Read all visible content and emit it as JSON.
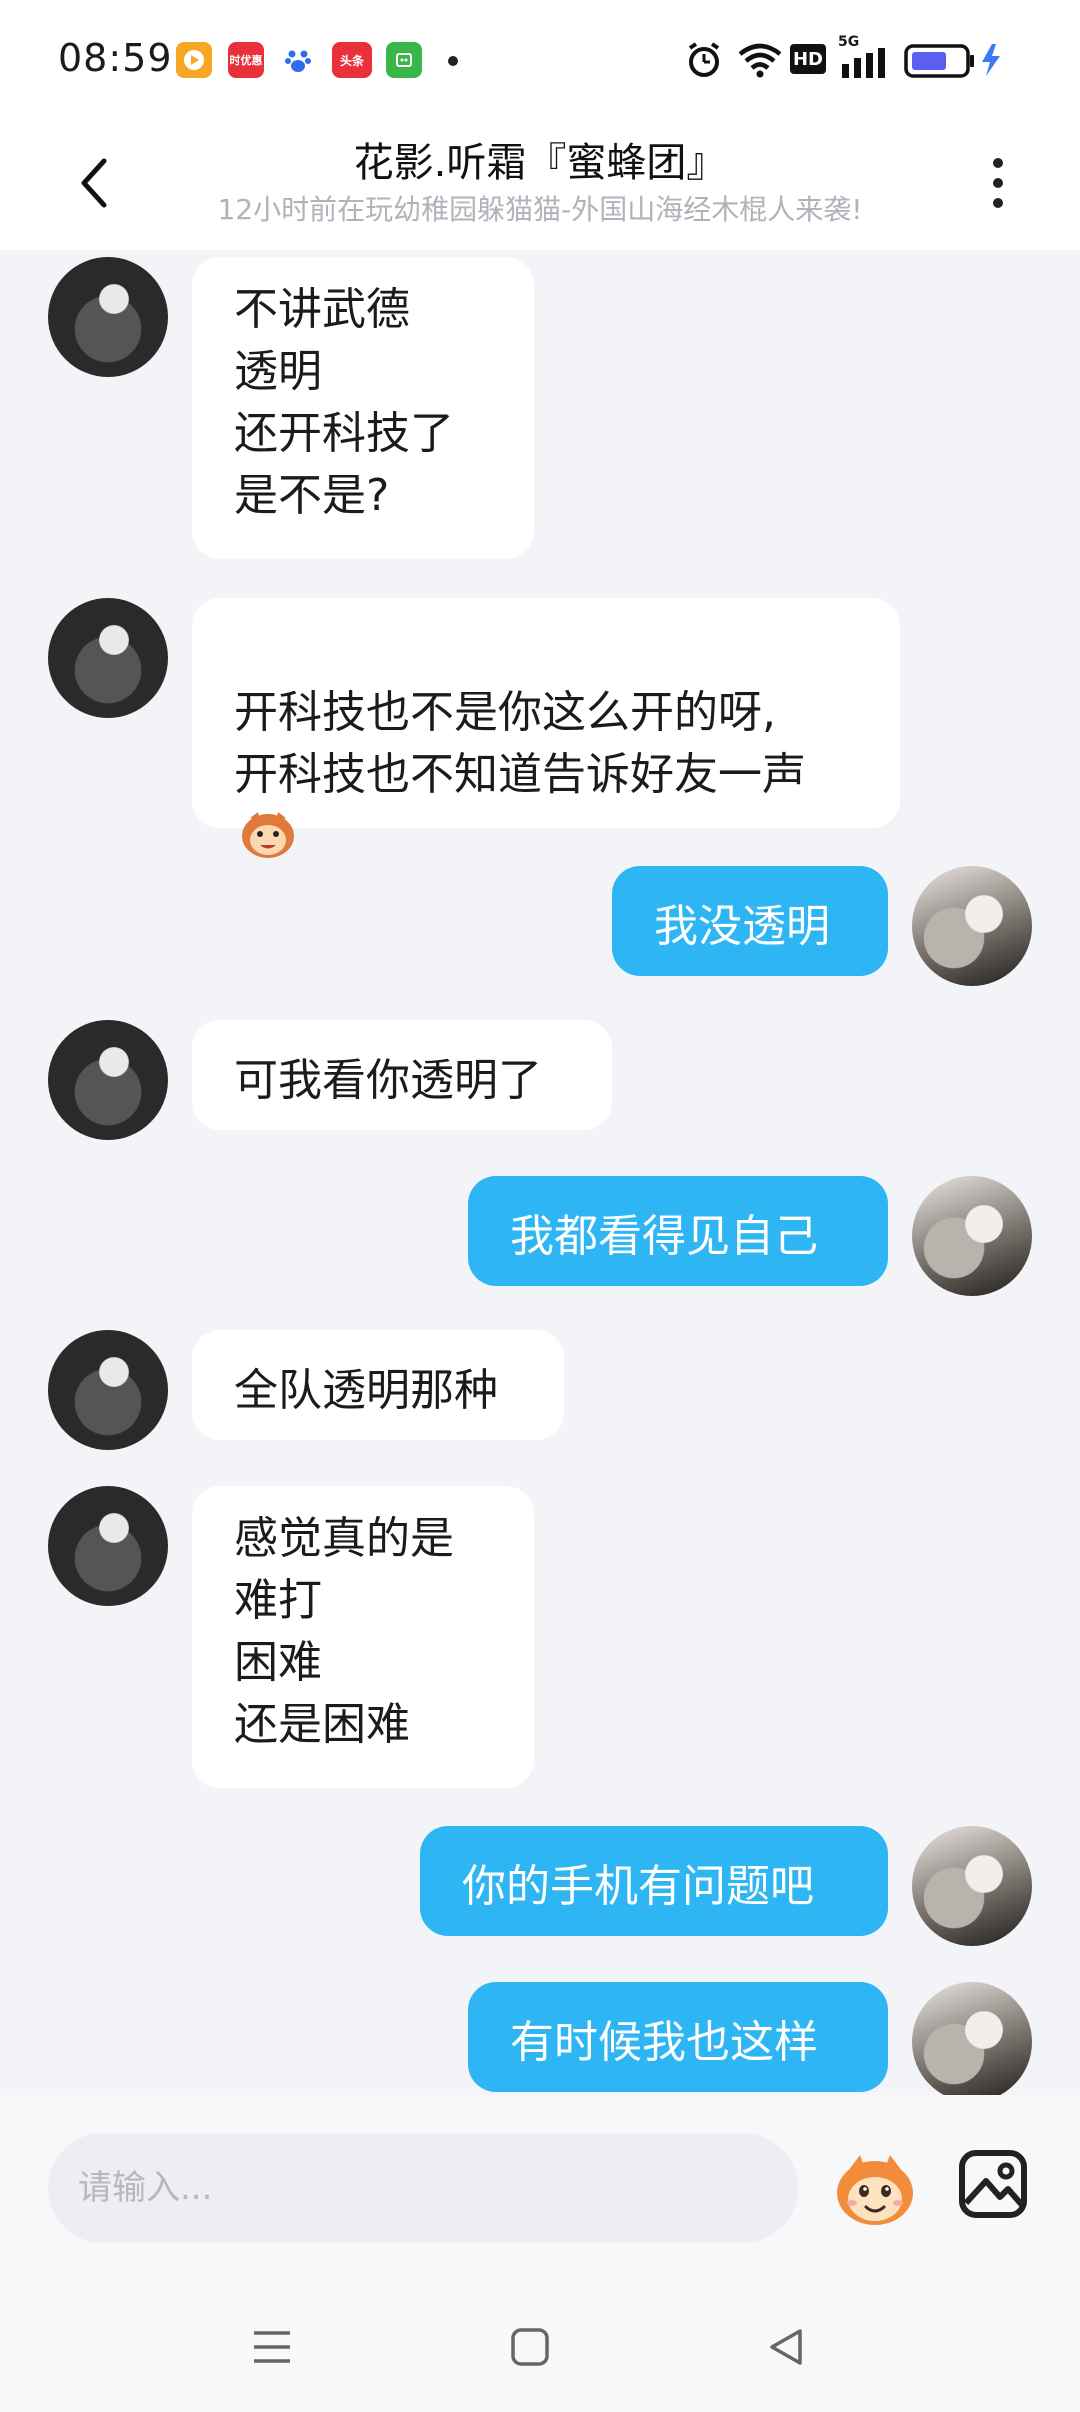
{
  "status_bar": {
    "time": "08:59",
    "app_icons": [
      {
        "name": "video-app-icon",
        "color": "#f6a623",
        "label": ""
      },
      {
        "name": "shopping-app-icon",
        "color": "#e8313a",
        "label": "时优惠"
      },
      {
        "name": "baidu-app-icon",
        "color": "#2f6bf0",
        "label": ""
      },
      {
        "name": "toutiao-app-icon",
        "color": "#e8313a",
        "label": "头条"
      },
      {
        "name": "wechat-mini-icon",
        "color": "#39b54a",
        "label": ""
      }
    ],
    "network_label": "5G",
    "hd_label": "HD"
  },
  "header": {
    "title": "花影.听霜『蜜蜂团』",
    "subtitle": "12小时前在玩幼稚园躲猫猫-外国山海经木棍人来袭!"
  },
  "messages": [
    {
      "side": "left",
      "text": "不讲武德\n透明\n还开科技了\n是不是?"
    },
    {
      "side": "left",
      "text": "开科技也不是你这么开的呀,\n开科技也不知道告诉好友一声",
      "has_emoji": true
    },
    {
      "side": "right",
      "text": "我没透明"
    },
    {
      "side": "left",
      "text": "可我看你透明了"
    },
    {
      "side": "right",
      "text": "我都看得见自己"
    },
    {
      "side": "left",
      "text": "全队透明那种"
    },
    {
      "side": "left",
      "text": "感觉真的是\n难打\n困难\n还是困难"
    },
    {
      "side": "right",
      "text": "你的手机有问题吧"
    },
    {
      "side": "right",
      "text": "有时候我也这样"
    }
  ],
  "input": {
    "placeholder": "请输入..."
  },
  "colors": {
    "accent": "#2db5f4",
    "background": "#f2f4f8"
  }
}
